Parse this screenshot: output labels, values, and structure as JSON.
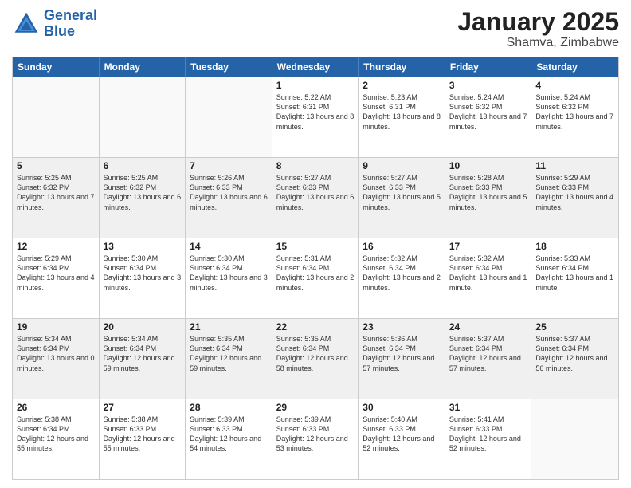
{
  "header": {
    "logo": {
      "line1": "General",
      "line2": "Blue"
    },
    "title": "January 2025",
    "subtitle": "Shamva, Zimbabwe"
  },
  "calendar": {
    "days_of_week": [
      "Sunday",
      "Monday",
      "Tuesday",
      "Wednesday",
      "Thursday",
      "Friday",
      "Saturday"
    ],
    "rows": [
      [
        {
          "day": "",
          "info": "",
          "empty": true
        },
        {
          "day": "",
          "info": "",
          "empty": true
        },
        {
          "day": "",
          "info": "",
          "empty": true
        },
        {
          "day": "1",
          "info": "Sunrise: 5:22 AM\nSunset: 6:31 PM\nDaylight: 13 hours\nand 8 minutes."
        },
        {
          "day": "2",
          "info": "Sunrise: 5:23 AM\nSunset: 6:31 PM\nDaylight: 13 hours\nand 8 minutes."
        },
        {
          "day": "3",
          "info": "Sunrise: 5:24 AM\nSunset: 6:32 PM\nDaylight: 13 hours\nand 7 minutes."
        },
        {
          "day": "4",
          "info": "Sunrise: 5:24 AM\nSunset: 6:32 PM\nDaylight: 13 hours\nand 7 minutes."
        }
      ],
      [
        {
          "day": "5",
          "info": "Sunrise: 5:25 AM\nSunset: 6:32 PM\nDaylight: 13 hours\nand 7 minutes."
        },
        {
          "day": "6",
          "info": "Sunrise: 5:25 AM\nSunset: 6:32 PM\nDaylight: 13 hours\nand 6 minutes."
        },
        {
          "day": "7",
          "info": "Sunrise: 5:26 AM\nSunset: 6:33 PM\nDaylight: 13 hours\nand 6 minutes."
        },
        {
          "day": "8",
          "info": "Sunrise: 5:27 AM\nSunset: 6:33 PM\nDaylight: 13 hours\nand 6 minutes."
        },
        {
          "day": "9",
          "info": "Sunrise: 5:27 AM\nSunset: 6:33 PM\nDaylight: 13 hours\nand 5 minutes."
        },
        {
          "day": "10",
          "info": "Sunrise: 5:28 AM\nSunset: 6:33 PM\nDaylight: 13 hours\nand 5 minutes."
        },
        {
          "day": "11",
          "info": "Sunrise: 5:29 AM\nSunset: 6:33 PM\nDaylight: 13 hours\nand 4 minutes."
        }
      ],
      [
        {
          "day": "12",
          "info": "Sunrise: 5:29 AM\nSunset: 6:34 PM\nDaylight: 13 hours\nand 4 minutes."
        },
        {
          "day": "13",
          "info": "Sunrise: 5:30 AM\nSunset: 6:34 PM\nDaylight: 13 hours\nand 3 minutes."
        },
        {
          "day": "14",
          "info": "Sunrise: 5:30 AM\nSunset: 6:34 PM\nDaylight: 13 hours\nand 3 minutes."
        },
        {
          "day": "15",
          "info": "Sunrise: 5:31 AM\nSunset: 6:34 PM\nDaylight: 13 hours\nand 2 minutes."
        },
        {
          "day": "16",
          "info": "Sunrise: 5:32 AM\nSunset: 6:34 PM\nDaylight: 13 hours\nand 2 minutes."
        },
        {
          "day": "17",
          "info": "Sunrise: 5:32 AM\nSunset: 6:34 PM\nDaylight: 13 hours\nand 1 minute."
        },
        {
          "day": "18",
          "info": "Sunrise: 5:33 AM\nSunset: 6:34 PM\nDaylight: 13 hours\nand 1 minute."
        }
      ],
      [
        {
          "day": "19",
          "info": "Sunrise: 5:34 AM\nSunset: 6:34 PM\nDaylight: 13 hours\nand 0 minutes."
        },
        {
          "day": "20",
          "info": "Sunrise: 5:34 AM\nSunset: 6:34 PM\nDaylight: 12 hours\nand 59 minutes."
        },
        {
          "day": "21",
          "info": "Sunrise: 5:35 AM\nSunset: 6:34 PM\nDaylight: 12 hours\nand 59 minutes."
        },
        {
          "day": "22",
          "info": "Sunrise: 5:35 AM\nSunset: 6:34 PM\nDaylight: 12 hours\nand 58 minutes."
        },
        {
          "day": "23",
          "info": "Sunrise: 5:36 AM\nSunset: 6:34 PM\nDaylight: 12 hours\nand 57 minutes."
        },
        {
          "day": "24",
          "info": "Sunrise: 5:37 AM\nSunset: 6:34 PM\nDaylight: 12 hours\nand 57 minutes."
        },
        {
          "day": "25",
          "info": "Sunrise: 5:37 AM\nSunset: 6:34 PM\nDaylight: 12 hours\nand 56 minutes."
        }
      ],
      [
        {
          "day": "26",
          "info": "Sunrise: 5:38 AM\nSunset: 6:34 PM\nDaylight: 12 hours\nand 55 minutes."
        },
        {
          "day": "27",
          "info": "Sunrise: 5:38 AM\nSunset: 6:33 PM\nDaylight: 12 hours\nand 55 minutes."
        },
        {
          "day": "28",
          "info": "Sunrise: 5:39 AM\nSunset: 6:33 PM\nDaylight: 12 hours\nand 54 minutes."
        },
        {
          "day": "29",
          "info": "Sunrise: 5:39 AM\nSunset: 6:33 PM\nDaylight: 12 hours\nand 53 minutes."
        },
        {
          "day": "30",
          "info": "Sunrise: 5:40 AM\nSunset: 6:33 PM\nDaylight: 12 hours\nand 52 minutes."
        },
        {
          "day": "31",
          "info": "Sunrise: 5:41 AM\nSunset: 6:33 PM\nDaylight: 12 hours\nand 52 minutes."
        },
        {
          "day": "",
          "info": "",
          "empty": true
        }
      ]
    ]
  }
}
